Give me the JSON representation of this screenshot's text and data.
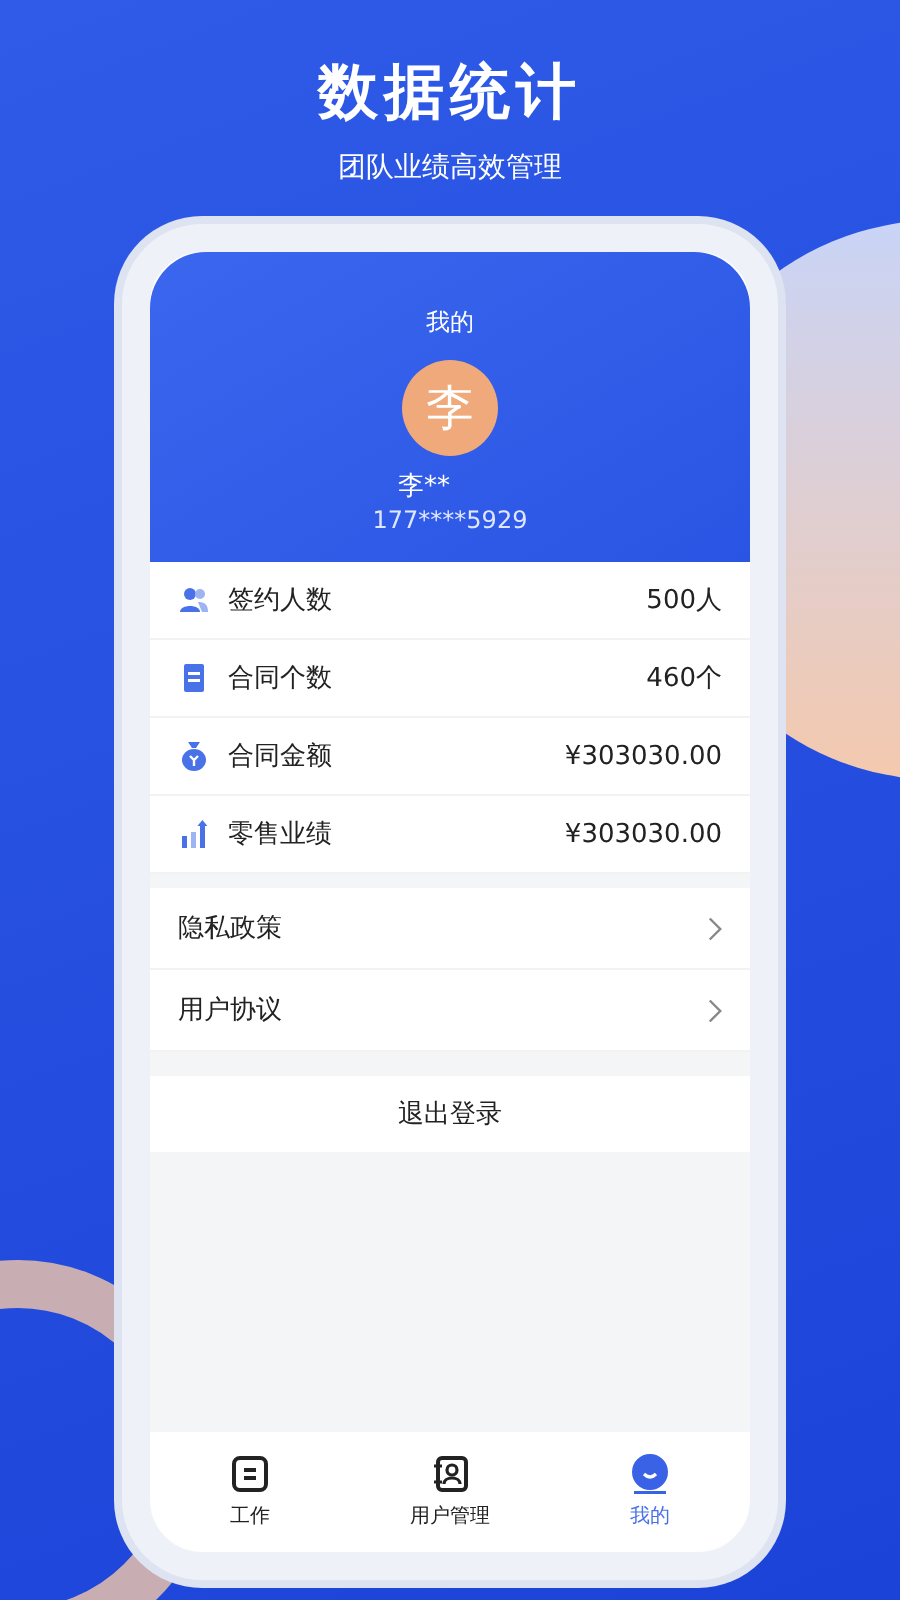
{
  "banner": {
    "title": "数据统计",
    "subtitle": "团队业绩高效管理"
  },
  "profile": {
    "title": "我的",
    "avatar_letter": "李",
    "name": "李**",
    "phone": "177****5929"
  },
  "stats": [
    {
      "label": "签约人数",
      "value": "500人"
    },
    {
      "label": "合同个数",
      "value": "460个"
    },
    {
      "label": "合同金额",
      "value": "¥303030.00"
    },
    {
      "label": "零售业绩",
      "value": "¥303030.00"
    }
  ],
  "menu": [
    {
      "label": "隐私政策"
    },
    {
      "label": "用户协议"
    }
  ],
  "logout": "退出登录",
  "tabs": [
    {
      "label": "工作",
      "selected": false
    },
    {
      "label": "用户管理",
      "selected": false
    },
    {
      "label": "我的",
      "selected": true
    }
  ]
}
